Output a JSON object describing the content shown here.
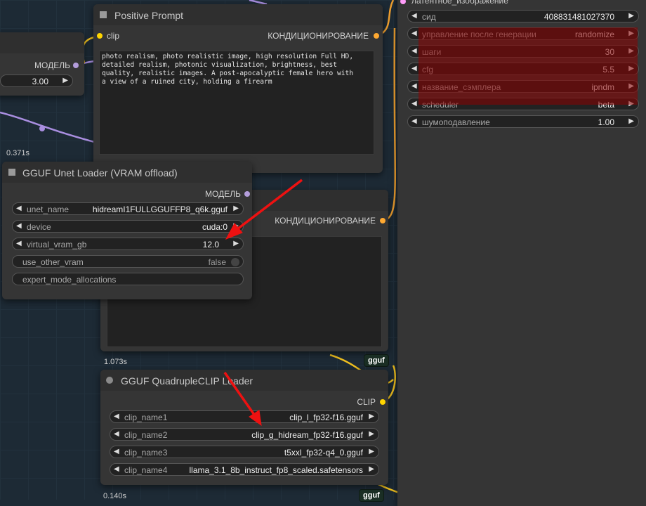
{
  "colors": {
    "canvas": "#1d2a35",
    "node_body": "#353535",
    "clip_port": "#ffd500",
    "model_port": "#b39ddb",
    "cond_port": "#ffa931",
    "latent_port": "#ff9cf9",
    "wire_yellow": "#f0c020",
    "wire_purple": "#a98ee0",
    "wire_orange": "#f0a030",
    "annotation_red": "#ee1111",
    "highlight_red": "#8c0000",
    "badge_green": "#1a2e24"
  },
  "left_partial": {
    "output_label": "МОДЕЛЬ",
    "widget_value": "3.00"
  },
  "positive_prompt": {
    "title": "Positive Prompt",
    "input_label": "clip",
    "output_label": "КОНДИЦИОНИРОВАНИЕ",
    "text_lines": [
      "photo realism, photo realistic image, high resolution Full HD,",
      "detailed realism, photonic visualization, brightness, best",
      "quality, realistic images. A post-apocalyptic female hero with",
      "a view of a ruined city, holding a firearm"
    ]
  },
  "timing_top": "0.371s",
  "unet_loader": {
    "title": "GGUF Unet Loader (VRAM offload)",
    "output_label": "МОДЕЛЬ",
    "widgets": [
      {
        "name": "unet_name",
        "value": "hidreamI1FULLGGUFFP8_q6k.gguf"
      },
      {
        "name": "device",
        "value": "cuda:0"
      },
      {
        "name": "virtual_vram_gb",
        "value": "12.0"
      },
      {
        "name": "use_other_vram",
        "value": "false"
      },
      {
        "name": "expert_mode_allocations",
        "value": ""
      }
    ]
  },
  "negative_prompt": {
    "output_label": "КОНДИЦИОНИРОВАНИЕ"
  },
  "timing_mid": "1.073s",
  "badge_mid": "gguf",
  "quad_clip": {
    "title": "GGUF QuadrupleCLIP Loader",
    "output_label": "CLIP",
    "widgets": [
      {
        "name": "clip_name1",
        "value": "clip_l_fp32-f16.gguf"
      },
      {
        "name": "clip_name2",
        "value": "clip_g_hidream_fp32-f16.gguf"
      },
      {
        "name": "clip_name3",
        "value": "t5xxl_fp32-q4_0.gguf"
      },
      {
        "name": "clip_name4",
        "value": "llama_3.1_8b_instruct_fp8_scaled.safetensors"
      }
    ]
  },
  "timing_bottom": "0.140s",
  "badge_bottom": "gguf",
  "ksampler": {
    "input_label": "латентное_изображение",
    "widgets": [
      {
        "name": "сид",
        "value": "408831481027370"
      },
      {
        "name": "управление после генерации",
        "value": "randomize"
      },
      {
        "name": "шаги",
        "value": "30"
      },
      {
        "name": "cfg",
        "value": "5.5"
      },
      {
        "name": "название_сэмплера",
        "value": "ipndm"
      },
      {
        "name": "scheduler",
        "value": "beta"
      },
      {
        "name": "шумоподавление",
        "value": "1.00"
      }
    ]
  }
}
